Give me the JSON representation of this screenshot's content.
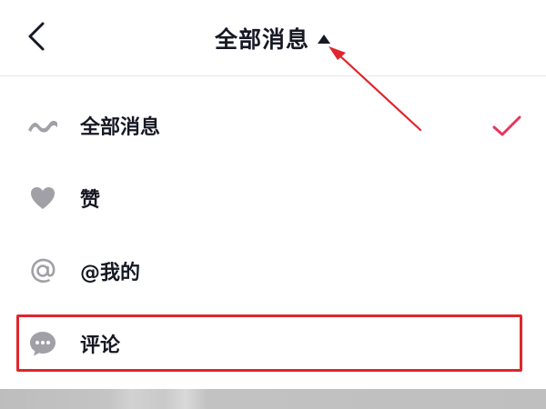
{
  "header": {
    "title": "全部消息",
    "back_icon": "chevron-left-icon",
    "caret_icon": "caret-up-icon"
  },
  "menu": {
    "items": [
      {
        "label": "全部消息",
        "icon": "wave-icon",
        "selected": true
      },
      {
        "label": "赞",
        "icon": "heart-icon",
        "selected": false
      },
      {
        "label": "@我的",
        "icon": "at-icon",
        "selected": false
      },
      {
        "label": "评论",
        "icon": "comment-bubble-icon",
        "selected": false
      }
    ]
  },
  "colors": {
    "text": "#161823",
    "icon_gray": "#a0a0a6",
    "check_pink": "#e8355d",
    "annotation_red": "#e0262d"
  }
}
